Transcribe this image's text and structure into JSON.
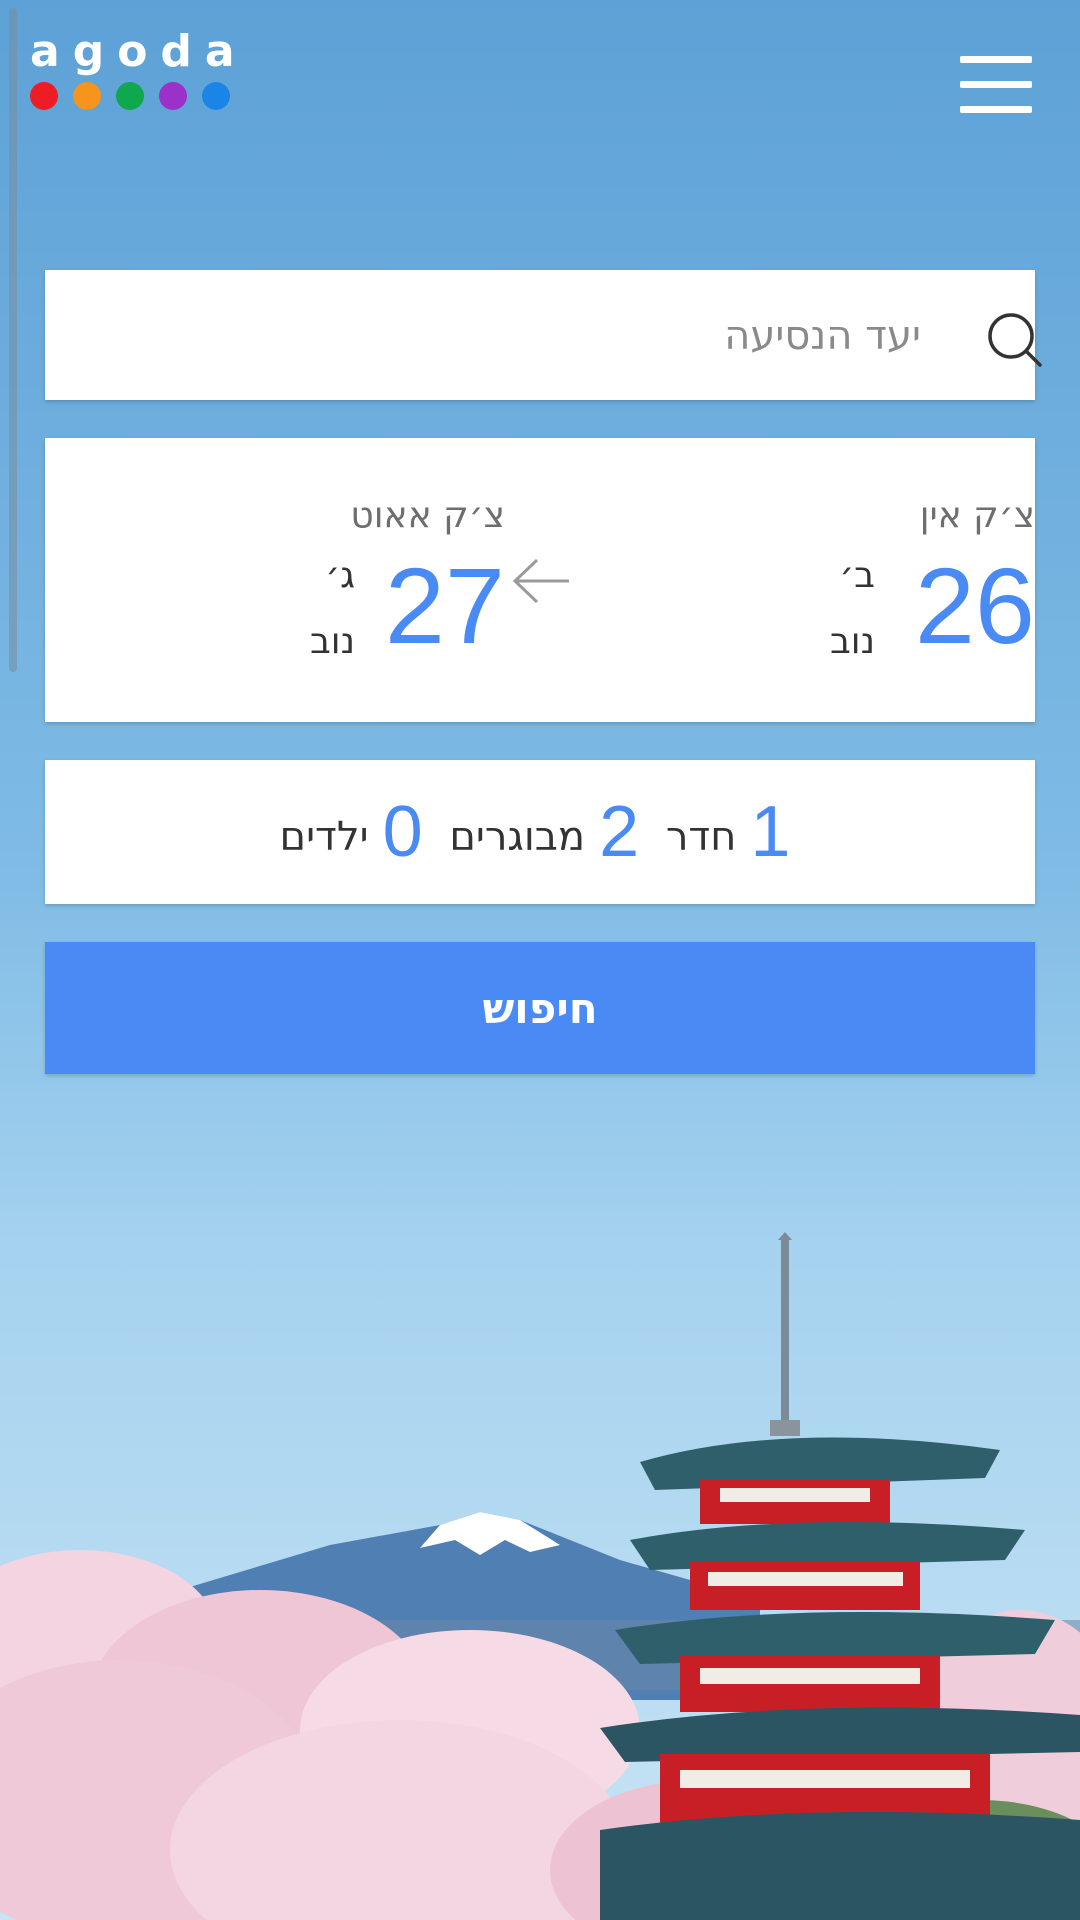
{
  "header": {
    "logo_text": "agoda",
    "logo_dot_colors": [
      "#ee1c25",
      "#f7941d",
      "#10a84e",
      "#9b31c9",
      "#1a85e6"
    ],
    "menu_icon": "hamburger-menu-icon"
  },
  "search": {
    "placeholder": "יעד הנסיעה",
    "icon": "search-icon"
  },
  "dates": {
    "checkin": {
      "label": "צ׳ק אין",
      "day": "26",
      "weekday": "ב׳",
      "month": "נוב"
    },
    "checkout": {
      "label": "צ׳ק אאוט",
      "day": "27",
      "weekday": "ג׳",
      "month": "נוב"
    },
    "arrow_icon": "arrow-left-icon"
  },
  "guests": {
    "rooms": "1",
    "rooms_label": "חדר",
    "adults": "2",
    "adults_label": "מבוגרים",
    "children": "0",
    "children_label": "ילדים"
  },
  "search_button": {
    "label": "חיפוש"
  },
  "colors": {
    "accent": "#4a8af4",
    "sky": "#5da4d8",
    "card": "#ffffff"
  }
}
